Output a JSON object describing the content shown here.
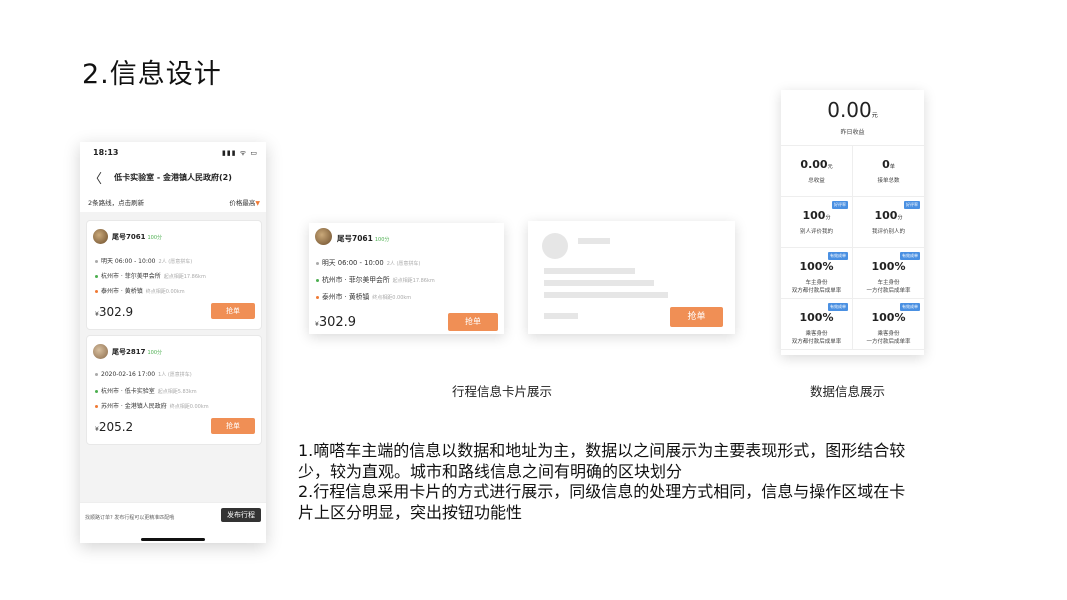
{
  "page_title": "2.信息设计",
  "phone": {
    "status_time": "18:13",
    "status_icons": "▮▮▮ ᯤ ▭",
    "nav_back": "〈",
    "nav_title": "低卡实验室 - 金港镇人民政府(2)",
    "route_info": "2条路线，点击刷新",
    "sort_label": "价格最高",
    "sort_arrow": "▼",
    "cards": [
      {
        "name": "尾号7061",
        "badge": "100分",
        "date": "明天 06:00 - 10:00",
        "seats": "2人 (愿意拼车)",
        "from": "杭州市 · 菲尔美甲会所",
        "from_dist": "起点相距17.86km",
        "to": "泰州市 · 黄桥镇",
        "to_dist": "终点相距0.00km",
        "currency": "¥",
        "price": "302.9",
        "action": "抢单"
      },
      {
        "name": "尾号2817",
        "badge": "100分",
        "date": "2020-02-16 17:00",
        "seats": "1人 (愿意拼车)",
        "from": "杭州市 · 低卡实验室",
        "from_dist": "起点相距5.83km",
        "to": "苏州市 · 金港镇人民政府",
        "to_dist": "终点相距0.00km",
        "currency": "¥",
        "price": "205.2",
        "action": "抢单"
      }
    ],
    "bottom_hint": "找顺路订单? 发布行程可以更精准匹配哦",
    "publish_button": "发布行程"
  },
  "trip_card": {
    "name": "尾号7061",
    "badge": "100分",
    "date": "明天 06:00 - 10:00",
    "seats": "2人 (愿意拼车)",
    "from": "杭州市 · 菲尔美甲会所",
    "from_dist": "起点相距17.86km",
    "to": "泰州市 · 黄桥镇",
    "to_dist": "终点相距0.00km",
    "currency": "¥",
    "price": "302.9",
    "action": "抢单"
  },
  "skeleton_card": {
    "action": "抢单"
  },
  "caption_trip": "行程信息卡片展示",
  "caption_data": "数据信息展示",
  "data_panel": {
    "top_value": "0.00",
    "top_unit": "元",
    "top_label": "昨日收益",
    "cells": [
      {
        "value": "0.00",
        "unit": "元",
        "label1": "总收益",
        "label2": "",
        "tag": ""
      },
      {
        "value": "0",
        "unit": "单",
        "label1": "接单总数",
        "label2": "",
        "tag": ""
      },
      {
        "value": "100",
        "unit": "分",
        "label1": "别人评价我的",
        "label2": "",
        "tag": "好评率"
      },
      {
        "value": "100",
        "unit": "分",
        "label1": "我评价别人的",
        "label2": "",
        "tag": "好评率"
      },
      {
        "value": "100%",
        "unit": "",
        "label1": "车主身份",
        "label2": "双方都付款后成单率",
        "tag": "有效成单"
      },
      {
        "value": "100%",
        "unit": "",
        "label1": "车主身份",
        "label2": "一方付款后成单率",
        "tag": "有效成单"
      },
      {
        "value": "100%",
        "unit": "",
        "label1": "乘客身份",
        "label2": "双方都付款后成单率",
        "tag": "有效成单"
      },
      {
        "value": "100%",
        "unit": "",
        "label1": "乘客身份",
        "label2": "一方付款后成单率",
        "tag": "有效成单"
      }
    ]
  },
  "description": [
    "1.嘀嗒车主端的信息以数据和地址为主，数据以之间展示为主要表现形式，图形结合较",
    "少，较为直观。城市和路线信息之间有明确的区块划分",
    "2.行程信息采用卡片的方式进行展示，同级信息的处理方式相同，信息与操作区域在卡",
    "片上区分明显，突出按钮功能性"
  ]
}
